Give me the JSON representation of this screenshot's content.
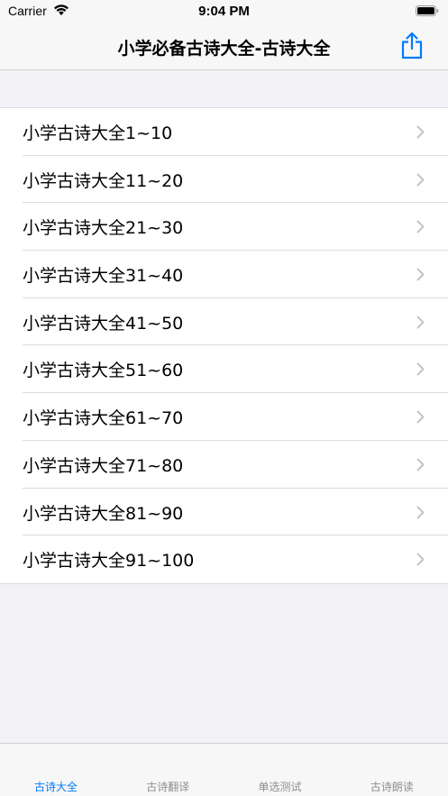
{
  "status_bar": {
    "carrier": "Carrier",
    "time": "9:04 PM"
  },
  "nav": {
    "title": "小学必备古诗大全-古诗大全",
    "share_icon": "share-icon"
  },
  "list": {
    "items": [
      {
        "label": "小学古诗大全1~10"
      },
      {
        "label": "小学古诗大全11~20"
      },
      {
        "label": "小学古诗大全21~30"
      },
      {
        "label": "小学古诗大全31~40"
      },
      {
        "label": "小学古诗大全41~50"
      },
      {
        "label": "小学古诗大全51~60"
      },
      {
        "label": "小学古诗大全61~70"
      },
      {
        "label": "小学古诗大全71~80"
      },
      {
        "label": "小学古诗大全81~90"
      },
      {
        "label": "小学古诗大全91~100"
      }
    ],
    "chevron_icon": "chevron-right-icon"
  },
  "tab_bar": {
    "tabs": [
      {
        "label": "古诗大全",
        "active": true
      },
      {
        "label": "古诗翻译",
        "active": false
      },
      {
        "label": "单选测试",
        "active": false
      },
      {
        "label": "古诗朗读",
        "active": false
      }
    ]
  },
  "colors": {
    "accent": "#007aff",
    "inactive_tab": "#8e8e93",
    "background": "#f2f2f7",
    "chevron": "#c4c4c7"
  }
}
